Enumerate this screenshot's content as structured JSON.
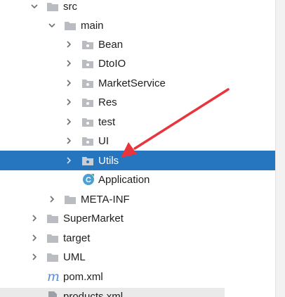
{
  "tree": {
    "items": [
      {
        "label": "src",
        "icon": "folder-icon",
        "expanded": true,
        "selected": false
      },
      {
        "label": "main",
        "icon": "folder-icon",
        "expanded": true,
        "selected": false
      },
      {
        "label": "Bean",
        "icon": "package-icon",
        "expanded": false,
        "selected": false
      },
      {
        "label": "DtoIO",
        "icon": "package-icon",
        "expanded": false,
        "selected": false
      },
      {
        "label": "MarketService",
        "icon": "package-icon",
        "expanded": false,
        "selected": false
      },
      {
        "label": "Res",
        "icon": "package-icon",
        "expanded": false,
        "selected": false
      },
      {
        "label": "test",
        "icon": "package-icon",
        "expanded": false,
        "selected": false
      },
      {
        "label": "UI",
        "icon": "package-icon",
        "expanded": false,
        "selected": false
      },
      {
        "label": "Utils",
        "icon": "package-icon",
        "expanded": false,
        "selected": true
      },
      {
        "label": "Application",
        "icon": "java-class-icon",
        "expanded": null,
        "selected": false
      },
      {
        "label": "META-INF",
        "icon": "folder-icon",
        "expanded": false,
        "selected": false
      },
      {
        "label": "SuperMarket",
        "icon": "folder-icon",
        "expanded": false,
        "selected": false
      },
      {
        "label": "target",
        "icon": "folder-icon",
        "expanded": false,
        "selected": false
      },
      {
        "label": "UML",
        "icon": "folder-icon",
        "expanded": false,
        "selected": false
      },
      {
        "label": "pom.xml",
        "icon": "maven-icon",
        "expanded": null,
        "selected": false
      },
      {
        "label": "products.xml",
        "icon": "xml-file-icon",
        "expanded": null,
        "selected": false
      }
    ]
  },
  "annotation": {
    "arrow_color": "#e8343c"
  },
  "colors": {
    "selection": "#2675bf",
    "folder": "#b9bdc2",
    "chevron": "#6e6e6e",
    "class_icon": "#48a0d4"
  }
}
